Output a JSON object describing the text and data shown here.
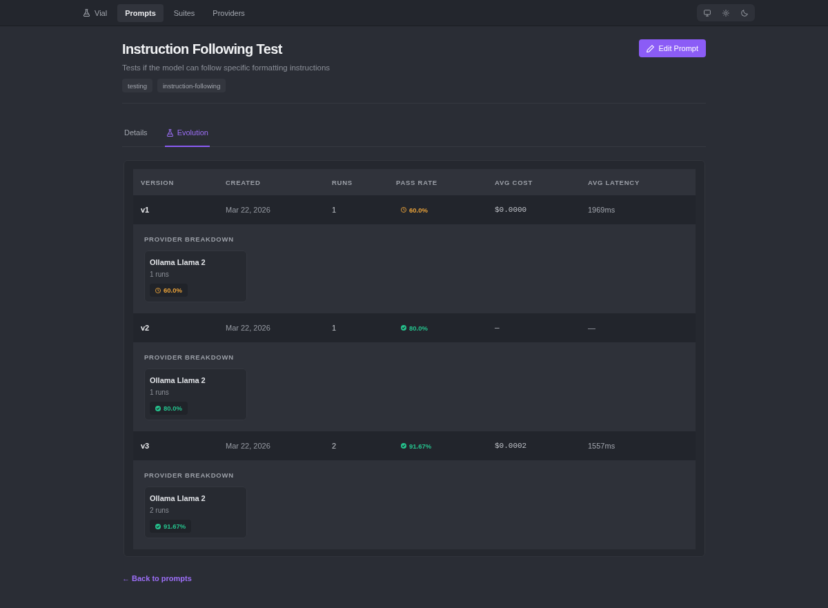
{
  "nav": {
    "brand": "Vial",
    "items": [
      {
        "label": "Prompts",
        "selected": true
      },
      {
        "label": "Suites",
        "selected": false
      },
      {
        "label": "Providers",
        "selected": false
      }
    ]
  },
  "header": {
    "title": "Instruction Following Test",
    "description": "Tests if the model can follow specific formatting instructions",
    "tags": [
      "testing",
      "instruction-following"
    ],
    "edit_button": "Edit Prompt"
  },
  "tabs": [
    {
      "label": "Details",
      "selected": false,
      "has_icon": false
    },
    {
      "label": "Evolution",
      "selected": true,
      "has_icon": true
    }
  ],
  "evolution_table": {
    "columns": [
      "VERSION",
      "CREATED",
      "RUNS",
      "PASS RATE",
      "AVG COST",
      "AVG LATENCY"
    ],
    "rows": [
      {
        "version": "v1",
        "created": "Mar 22, 2026",
        "runs": "1",
        "pass_rate": {
          "value": "60.0%",
          "kind": "warning"
        },
        "avg_cost": "$0.0000",
        "avg_latency": "1969ms",
        "breakdown": {
          "heading": "PROVIDER BREAKDOWN",
          "providers": [
            {
              "name": "Ollama Llama 2",
              "runs": "1 runs",
              "pass_rate": {
                "value": "60.0%",
                "kind": "warning"
              }
            }
          ]
        }
      },
      {
        "version": "v2",
        "created": "Mar 22, 2026",
        "runs": "1",
        "pass_rate": {
          "value": "80.0%",
          "kind": "pass"
        },
        "avg_cost": "—",
        "avg_latency": "—",
        "breakdown": {
          "heading": "PROVIDER BREAKDOWN",
          "providers": [
            {
              "name": "Ollama Llama 2",
              "runs": "1 runs",
              "pass_rate": {
                "value": "80.0%",
                "kind": "pass"
              }
            }
          ]
        }
      },
      {
        "version": "v3",
        "created": "Mar 22, 2026",
        "runs": "2",
        "pass_rate": {
          "value": "91.67%",
          "kind": "pass"
        },
        "avg_cost": "$0.0002",
        "avg_latency": "1557ms",
        "breakdown": {
          "heading": "PROVIDER BREAKDOWN",
          "providers": [
            {
              "name": "Ollama Llama 2",
              "runs": "2 runs",
              "pass_rate": {
                "value": "91.67%",
                "kind": "pass"
              }
            }
          ]
        }
      }
    ]
  },
  "back_link": "← Back to prompts"
}
